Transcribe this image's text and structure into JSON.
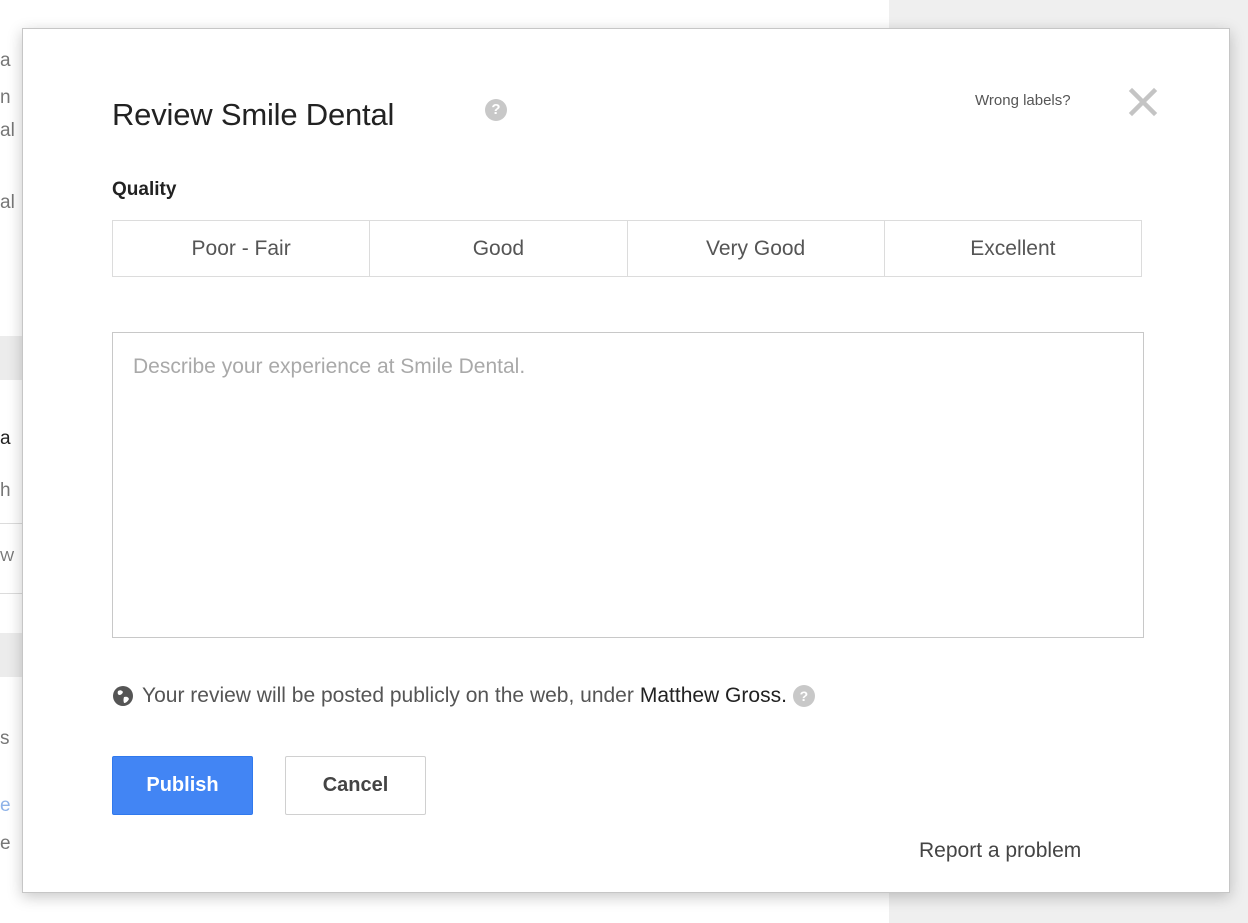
{
  "background": {
    "fragments": [
      "a",
      "n",
      "al",
      "al",
      "a",
      "h",
      "W",
      "s",
      "e",
      "e"
    ]
  },
  "dialog": {
    "title": "Review Smile Dental",
    "title_help_icon": "?",
    "wrong_labels": "Wrong labels?",
    "close_icon": "close-icon",
    "quality_label": "Quality",
    "rating_options": [
      "Poor - Fair",
      "Good",
      "Very Good",
      "Excellent"
    ],
    "review_placeholder": "Describe your experience at Smile Dental.",
    "review_value": "",
    "notice_text": "Your review will be posted publicly on the web, under",
    "notice_name": "Matthew Gross.",
    "notice_help_icon": "?",
    "publish_label": "Publish",
    "cancel_label": "Cancel",
    "report_link": "Report a problem"
  },
  "colors": {
    "primary_button": "#4285f4",
    "border": "#dcdcdc",
    "placeholder": "#a9a9a9"
  }
}
